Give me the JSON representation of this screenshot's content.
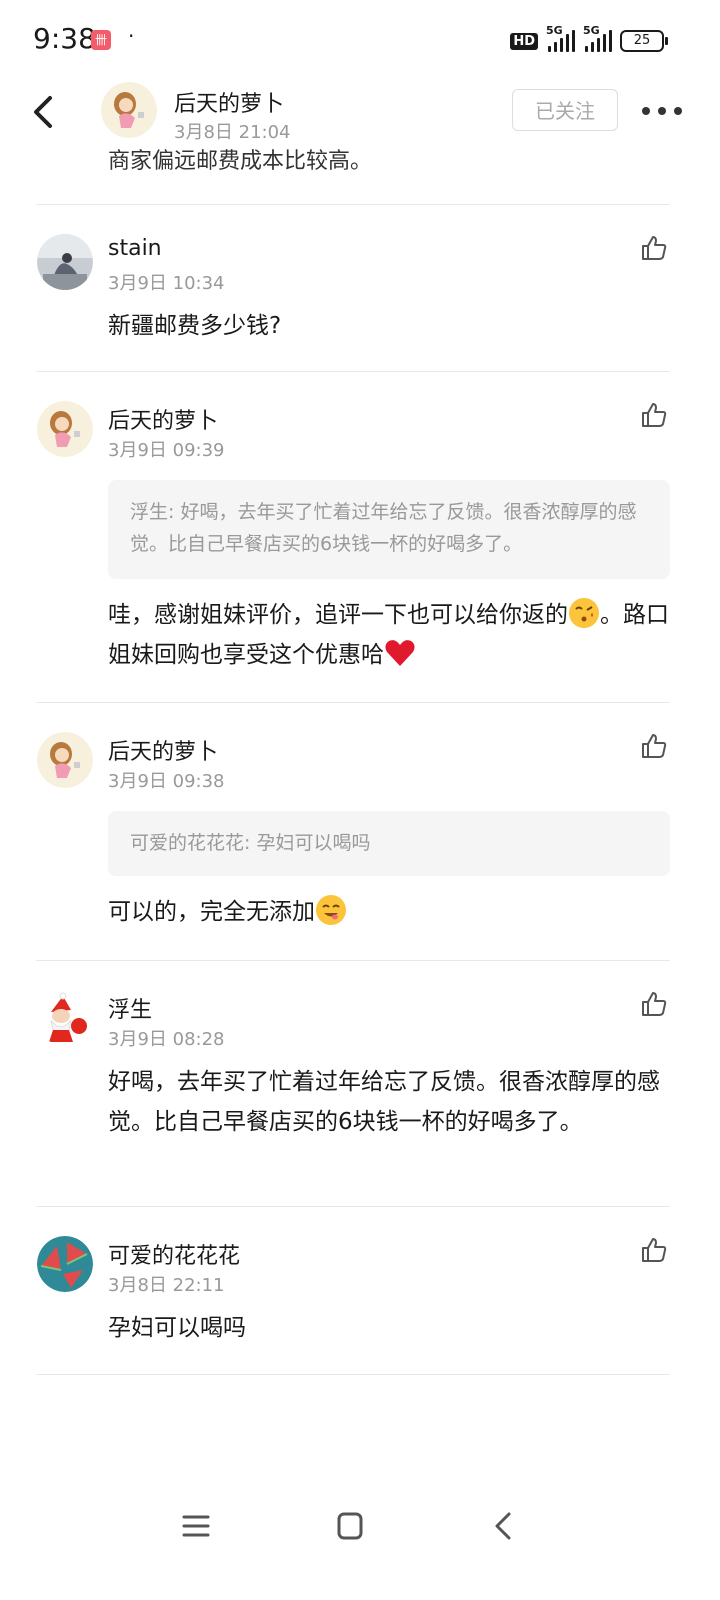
{
  "status_bar": {
    "time": "9:38",
    "app_icon_glyph": "卌",
    "dot": "·",
    "hd": "HD",
    "sim1": "5G",
    "sim2": "5G",
    "battery": "25"
  },
  "header": {
    "name": "后天的萝卜",
    "date": "3月8日 21:04",
    "follow_label": "已关注"
  },
  "clipped_text": "商家偏远邮费成本比较高。",
  "comments": [
    {
      "name": "stain",
      "time": "3月9日 10:34",
      "body": "新疆邮费多少钱?"
    },
    {
      "name": "后天的萝卜",
      "time": "3月9日 09:39",
      "quote": "浮生: 好喝，去年买了忙着过年给忘了反馈。很香浓醇厚的感觉。比自己早餐店买的6块钱一杯的好喝多了。",
      "body_part1": "哇，感谢姐妹评价，追评一下也可以给你返的",
      "body_part2": "。路口姐妹回购也享受这个优惠哈"
    },
    {
      "name": "后天的萝卜",
      "time": "3月9日 09:38",
      "quote": "可爱的花花花: 孕妇可以喝吗",
      "body": "可以的，完全无添加"
    },
    {
      "name": "浮生",
      "time": "3月9日 08:28",
      "body": "好喝，去年买了忙着过年给忘了反馈。很香浓醇厚的感觉。比自己早餐店买的6块钱一杯的好喝多了。"
    },
    {
      "name": "可爱的花花花",
      "time": "3月8日 22:11",
      "body": "孕妇可以喝吗"
    }
  ],
  "icons": {
    "back": "chevron-left-icon",
    "more": "more-dots-icon",
    "like": "thumbs-up-icon",
    "nav_menu": "menu-icon",
    "nav_home": "home-square-icon",
    "nav_back": "back-chevron-icon"
  }
}
